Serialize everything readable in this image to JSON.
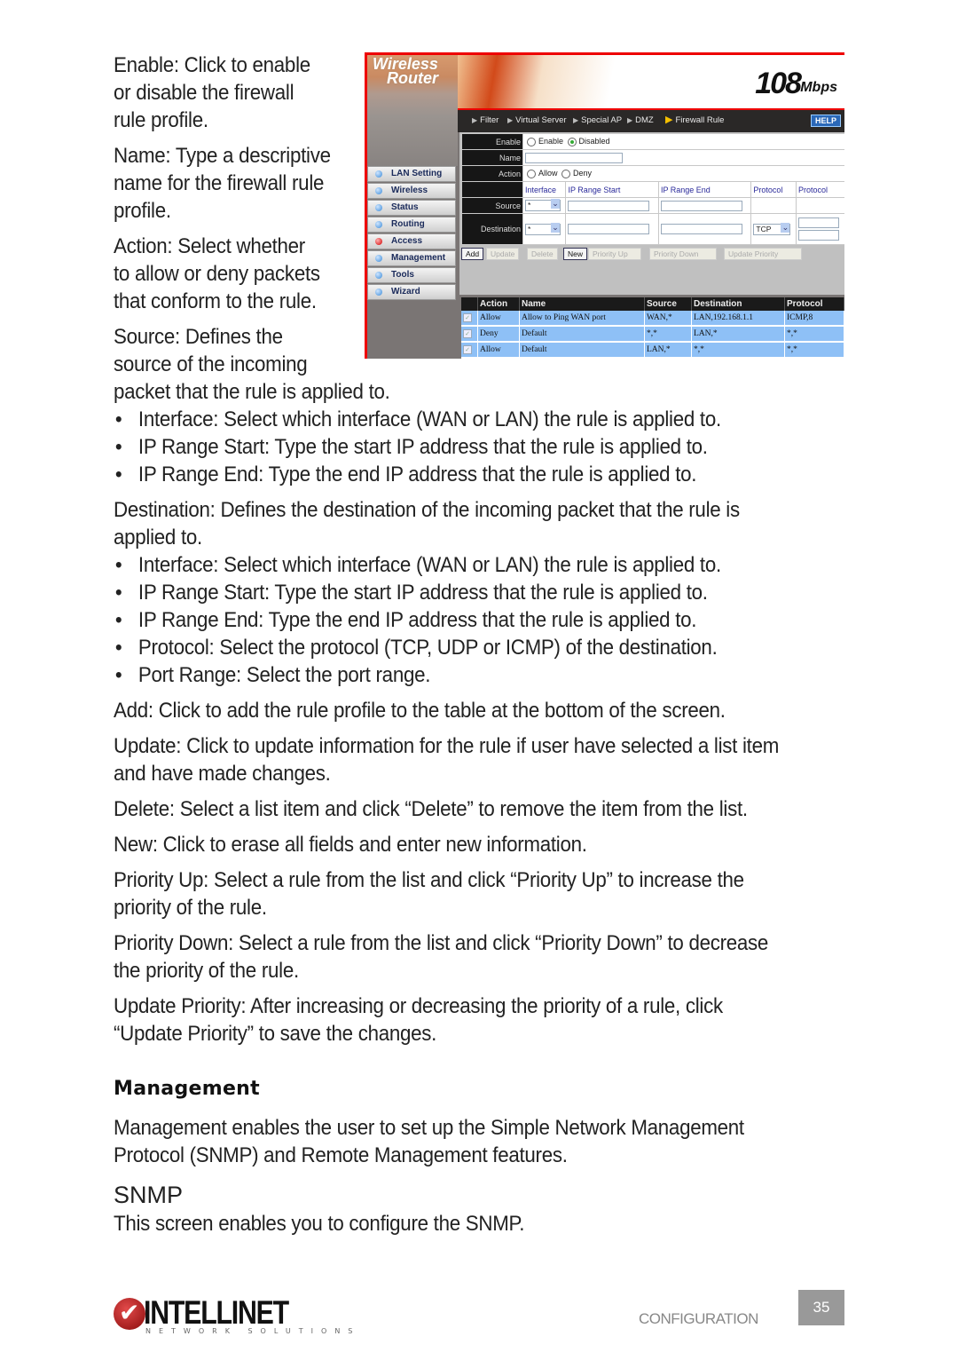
{
  "intro_paragraphs": [
    [
      "Enable: Click to enable",
      "or disable the firewall",
      "rule profile."
    ],
    [
      "Name: Type a descriptive",
      "name for the firewall rule",
      "profile."
    ],
    [
      "Action: Select whether",
      "to allow or deny packets",
      "that conform to the rule."
    ],
    [
      "Source: Defines the",
      "source of the incoming",
      "packet that the rule is applied to."
    ]
  ],
  "source_bullets": [
    "Interface: Select which interface (WAN or LAN) the rule is applied to.",
    "IP Range Start: Type the start IP address that the rule is applied to.",
    "IP Range End: Type the end IP address that the rule is applied to."
  ],
  "destination": {
    "lines": [
      "Destination: Defines the destination of the incoming packet that the rule is",
      "applied to."
    ],
    "bullets": [
      "Interface: Select which interface (WAN or LAN) the rule is applied to.",
      "IP Range Start: Type the start IP address that the rule is applied to.",
      "IP Range End: Type the end IP address that the rule is applied to.",
      "Protocol: Select the protocol (TCP, UDP or ICMP) of the destination.",
      "Port Range: Select the port range."
    ]
  },
  "button_descriptions": [
    [
      "Add: Click to add the rule profile to the table at the bottom of the screen."
    ],
    [
      "Update: Click to update information for the rule if user have selected a list item",
      "and have made changes."
    ],
    [
      "Delete: Select a list item and click “Delete” to remove the item from the list."
    ],
    [
      "New: Click to erase all fields and enter new information."
    ],
    [
      "Priority Up: Select a rule from the list and click “Priority Up” to increase the",
      "priority of the rule."
    ],
    [
      "Priority Down: Select a rule from the list and click “Priority Down” to decrease",
      "the priority of the rule."
    ],
    [
      "Update Priority: After increasing or decreasing the priority of a rule, click",
      "“Update Priority” to save the changes."
    ]
  ],
  "management": {
    "heading": "Management",
    "lines": [
      "Management enables the user to set up the Simple Network Management",
      "Protocol (SNMP) and Remote Management features."
    ],
    "snmp_heading": "SNMP",
    "snmp_text": "This screen enables you to configure the SNMP."
  },
  "router_ui": {
    "brand_line1": "Wireless",
    "brand_line2": "Router",
    "speed": "108",
    "speed_unit": "Mbps",
    "tabs": [
      {
        "label": "Filter",
        "active": false
      },
      {
        "label": "Virtual Server",
        "active": false
      },
      {
        "label": "Special AP",
        "active": false
      },
      {
        "label": "DMZ",
        "active": false
      },
      {
        "label": "Firewall Rule",
        "active": true
      }
    ],
    "help_label": "HELP",
    "nav": [
      {
        "label": "LAN Setting",
        "active": false
      },
      {
        "label": "Wireless",
        "active": false
      },
      {
        "label": "Status",
        "active": false
      },
      {
        "label": "Routing",
        "active": false
      },
      {
        "label": "Access",
        "active": true
      },
      {
        "label": "Management",
        "active": false
      },
      {
        "label": "Tools",
        "active": false
      },
      {
        "label": "Wizard",
        "active": false
      }
    ],
    "form": {
      "enable_label": "Enable",
      "enable_options": [
        "Enable",
        "Disabled"
      ],
      "enable_selected": "Disabled",
      "name_label": "Name",
      "name_value": "",
      "action_label": "Action",
      "action_options": [
        "Allow",
        "Deny"
      ],
      "action_selected": null,
      "col_headers": [
        "Interface",
        "IP Range Start",
        "IP Range End",
        "Protocol",
        "Protocol"
      ],
      "source_label": "Source",
      "source_interface": "*",
      "destination_label": "Destination",
      "destination_interface": "*",
      "destination_protocol": "TCP",
      "port_separator": "-"
    },
    "buttons": [
      {
        "label": "Add",
        "enabled": true
      },
      {
        "label": "Update",
        "enabled": false
      },
      {
        "label": "Delete",
        "enabled": false
      },
      {
        "label": "New",
        "enabled": true
      },
      {
        "label": "Priority Up",
        "enabled": false
      },
      {
        "label": "Priority Down",
        "enabled": false
      },
      {
        "label": "Update Priority",
        "enabled": false
      }
    ],
    "rules_table": {
      "headers": [
        "",
        "Action",
        "Name",
        "Source",
        "Destination",
        "Protocol"
      ],
      "rows": [
        {
          "checked": true,
          "action": "Allow",
          "name": "Allow to Ping WAN port",
          "source": "WAN,*",
          "destination": "LAN,192.168.1.1",
          "protocol": "ICMP,8"
        },
        {
          "checked": true,
          "action": "Deny",
          "name": "Default",
          "source": "*,*",
          "destination": "LAN,*",
          "protocol": "*,*"
        },
        {
          "checked": true,
          "action": "Allow",
          "name": "Default",
          "source": "LAN,*",
          "destination": "*,*",
          "protocol": "*,*"
        }
      ]
    }
  },
  "footer": {
    "logo_text": "INTELLINET",
    "logo_subtext": "NETWORK SOLUTIONS",
    "section": "CONFIGURATION",
    "page_number": "35"
  }
}
